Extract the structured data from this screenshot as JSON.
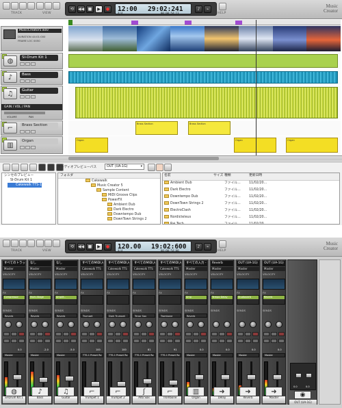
{
  "track_view": {
    "toolbar": {
      "groups": [
        {
          "label": "TRACK"
        },
        {
          "label": "VIEW"
        }
      ],
      "help_label": "HELP",
      "brand_line1": "Music",
      "brand_line2": "Creator",
      "transport_time": "12:00",
      "transport_time_label": "TEMPO",
      "transport_meter": "29:02:241",
      "transport_meter_label": "TIME (M:B:T)",
      "transport_sub": "4/4",
      "transport_sub2": "00:00:54:13"
    },
    "project": {
      "title": "MusicCreator5.wav",
      "line1": "DURATION",
      "line1_value": "44:01:000",
      "line2": "FRAME LOC",
      "line2_value": "0050"
    },
    "tracks": [
      {
        "num": "1",
        "name": "SI-Drum Kit 1",
        "icon": "drum-kit-icon"
      },
      {
        "num": "2",
        "name": "Bass",
        "icon": "bass-guitar-icon"
      },
      {
        "num": "3",
        "name": "Guitar",
        "icon": "guitar-icon"
      },
      {
        "num": "4",
        "name": "Brass Section",
        "icon": "trumpet-icon"
      },
      {
        "num": "5",
        "name": "Organ",
        "icon": "keyboard-icon"
      }
    ],
    "gain_row": {
      "label": "GAIN / VOL / PAN",
      "sub1": "VOLUME",
      "sub2": "PAN"
    },
    "clips": {
      "brass_label": "Brass Section",
      "organ_label": "Organ"
    }
  },
  "browser": {
    "toolbar": {
      "preview_label": "オーディオプレビューバス",
      "preview_value": "OUT (UA-1G)"
    },
    "left_header": "シンセのプレビュー",
    "left_items": [
      "SI-Drum Kit 1",
      "Cakewalk TTS-1 1"
    ],
    "folder_header": "フォルダ",
    "folders": [
      "Cakewalk",
      "Music Creator 5",
      "Sample Content",
      "MIDI Groove Clips",
      "PowerFX",
      "Ambient Dub",
      "Dark Electro",
      "Downtempo Dub",
      "DownTown Strings 2"
    ],
    "cols": [
      "名前",
      "サイズ",
      "種類",
      "更新日時"
    ],
    "files": [
      {
        "name": "Ambient Dub",
        "size": "",
        "type": "ファイル...",
        "date": "11/02/20..."
      },
      {
        "name": "Dark Electro",
        "size": "",
        "type": "ファイル...",
        "date": "11/02/20..."
      },
      {
        "name": "Downtempo Dub",
        "size": "",
        "type": "ファイル...",
        "date": "11/02/20..."
      },
      {
        "name": "DownTown Strings 2",
        "size": "",
        "type": "ファイル...",
        "date": "11/02/20..."
      },
      {
        "name": "ElectroClash",
        "size": "",
        "type": "ファイル...",
        "date": "11/02/20..."
      },
      {
        "name": "Nordicteleus",
        "size": "",
        "type": "ファイル...",
        "date": "11/02/20..."
      },
      {
        "name": "Rai Tech",
        "size": "",
        "type": "ファイル...",
        "date": "11/02/20..."
      }
    ]
  },
  "console": {
    "toolbar": {
      "groups": [
        {
          "label": "TRACK"
        },
        {
          "label": "VIEW"
        }
      ],
      "help_label": "HELP",
      "brand_line1": "Music",
      "brand_line2": "Creator",
      "transport_time": "120.00",
      "transport_meter": "19:02:600",
      "transport_sub": "4/4",
      "transport_sub2": "00:00:54:00"
    },
    "section_labels": {
      "fx": "FX",
      "sends": "SENDS",
      "velocity": "VELOCITY"
    },
    "strips": [
      {
        "hd": "すべてのトラック",
        "hd2": "Master",
        "fx": "Compressor",
        "send": "Reverb",
        "out": "Master",
        "reading": "0.0",
        "label": "SI-Drum Kit 1",
        "icon": "drum-kit-icon",
        "meter": 0.55,
        "fader": 0.55
      },
      {
        "hd": "なし",
        "hd2": "Master",
        "fx": "Multi-Stage",
        "send": "Reverb",
        "out": "Master",
        "reading": "-2.0",
        "label": "Bass",
        "icon": "bass-guitar-icon",
        "meter": 0.7,
        "fader": 0.45
      },
      {
        "hd": "なし",
        "hd2": "Master",
        "fx": "Amplif...",
        "send": "Reverb",
        "out": "Master",
        "reading": "-5.0",
        "label": "Guitar",
        "icon": "guitar-icon",
        "meter": 0.6,
        "fader": 0.5
      },
      {
        "hd": "すべてのMIDI入力 -",
        "hd2": "Cakewalk TTS",
        "fx": "",
        "send": "Trumpet",
        "out": "TTS-1 Preset Ro",
        "reading": "100",
        "label": "Trumpet 1",
        "icon": "trumpet-icon",
        "meter": 0.0,
        "fader": 0.3
      },
      {
        "hd": "すべてのMIDI入力 -",
        "hd2": "Cakewalk TTS",
        "fx": "",
        "send": "Dark Trumpet",
        "out": "TTS-1 Preset Ro",
        "reading": "100",
        "label": "Trumpet 2",
        "icon": "trumpet-icon",
        "meter": 0.0,
        "fader": 0.3
      },
      {
        "hd": "すべてのMIDI入力 -",
        "hd2": "Cakewalk TTS",
        "fx": "",
        "send": "Tenor Sax",
        "out": "TTS-1 Preset Ro",
        "reading": "81",
        "label": "Alto Sax",
        "icon": "sax-icon",
        "meter": 0.0,
        "fader": 0.4
      },
      {
        "hd": "すべてのMIDI入力 -",
        "hd2": "Cakewalk TTS",
        "fx": "",
        "send": "Trombone",
        "out": "TTS-1 Preset Ro",
        "reading": "91",
        "label": "Trombone",
        "icon": "trombone-icon",
        "meter": 0.0,
        "fader": 0.35
      },
      {
        "hd": "すべての入力 -",
        "hd2": "Master",
        "fx": "Amp",
        "send": "Reverb",
        "out": "Master",
        "reading": "0.0",
        "label": "Organ",
        "icon": "keyboard-icon",
        "meter": 0.4,
        "fader": 0.55
      },
      {
        "hd": "Reverb",
        "hd2": "Master",
        "fx": "Tempo Delay",
        "send": "",
        "out": "Master",
        "reading": "0.0",
        "label": "Delay",
        "icon": "arrow-icon",
        "meter": 0.2,
        "fader": 0.55
      },
      {
        "hd": "OUT (UA-1G)",
        "hd2": "Master",
        "fx": "Studioverb",
        "send": "",
        "out": "Master",
        "reading": "0.0",
        "label": "Reverb",
        "icon": "arrow-icon",
        "meter": 0.3,
        "fader": 0.55
      },
      {
        "hd": "OUT (UA-1G)",
        "hd2": "Master",
        "fx": "Reverb",
        "send": "",
        "out": "Master",
        "reading": "0.0",
        "label": "Master",
        "icon": "arrow-icon",
        "meter": 0.45,
        "fader": 0.55
      }
    ],
    "output": {
      "label": "OUT (UA-1G)",
      "left": "0.0",
      "right": "0.0",
      "icon": "speaker-icon"
    }
  }
}
